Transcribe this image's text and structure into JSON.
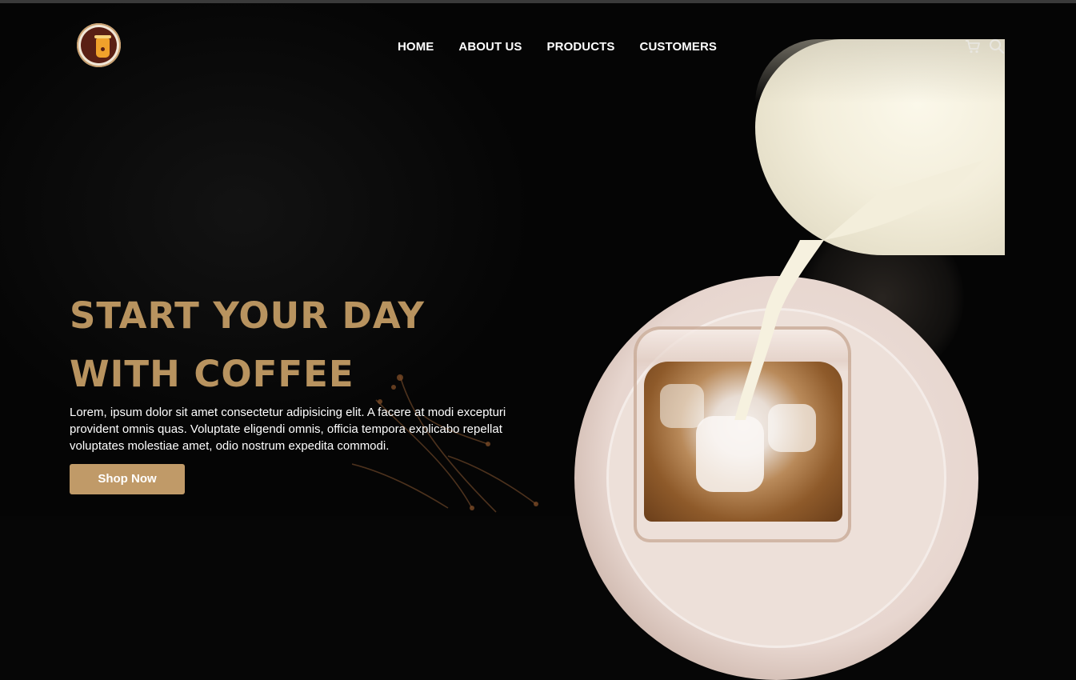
{
  "header": {
    "logo_icon": "coffee-cup-logo-icon",
    "nav": [
      {
        "label": "HOME"
      },
      {
        "label": "ABOUT US"
      },
      {
        "label": "PRODUCTS"
      },
      {
        "label": "CUSTOMERS"
      }
    ],
    "icons": [
      "cart-icon",
      "search-icon"
    ]
  },
  "hero": {
    "title_line1": "START YOUR DAY",
    "title_line2": "WITH COFFEE",
    "description": "Lorem, ipsum dolor sit amet consectetur adipisicing elit. A facere at modi excepturi provident omnis quas. Voluptate eligendi omnis, officia tempora explicabo repellat voluptates molestiae amet, odio nostrum expedita commodi.",
    "button_label": "Shop Now"
  },
  "colors": {
    "background": "#060606",
    "accent": "#b8935f",
    "button": "#c09a68",
    "nav_text": "#ffffff"
  }
}
